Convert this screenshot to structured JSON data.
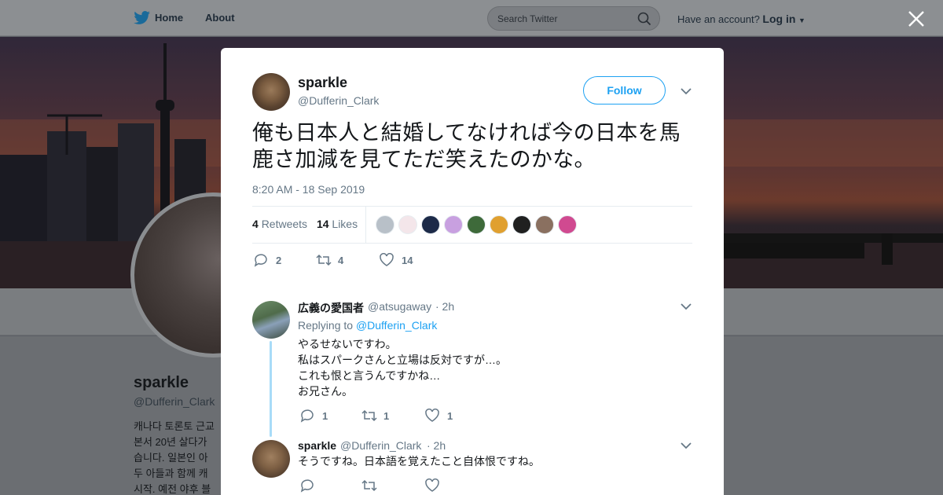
{
  "topbar": {
    "home_label": "Home",
    "about_label": "About",
    "search_placeholder": "Search Twitter",
    "account_prompt": "Have an account?",
    "login_label": "Log in"
  },
  "profile": {
    "name": "sparkle",
    "handle": "@Dufferin_Clark",
    "bio_lines": [
      "캐나다 토론토 근교",
      "본서 20년 살다가",
      "습니다. 일본인 아",
      "두 아들과 함께 캐",
      "시작. 예전 야후 블"
    ]
  },
  "tweet": {
    "author_name": "sparkle",
    "author_handle": "@Dufferin_Clark",
    "follow_label": "Follow",
    "text": "俺も日本人と結婚してなければ今の日本を馬鹿さ加減を見てただ笑えたのかな。",
    "timestamp": "8:20 AM - 18 Sep 2019",
    "retweets_count": "4",
    "retweets_label": "Retweets",
    "likes_count": "14",
    "likes_label": "Likes",
    "reply_count": "2",
    "retweet_count": "4",
    "like_count": "14",
    "liker_avatar_colors": [
      "#b8c0c8",
      "#f4e6ea",
      "#1c2a48",
      "#c8a0e0",
      "#3e6a3a",
      "#e0a030",
      "#202020",
      "#8a7060",
      "#d04a90"
    ]
  },
  "replies": [
    {
      "name": "広義の愛国者",
      "handle": "@atsugaway",
      "time": "· 2h",
      "replying_prefix": "Replying to",
      "replying_to": "@Dufferin_Clark",
      "lines": [
        "やるせないですわ。",
        "私はスパークさんと立場は反対ですが…。",
        "これも恨と言うんですかね…",
        "お兄さん。"
      ],
      "reply_count": "1",
      "retweet_count": "1",
      "like_count": "1"
    },
    {
      "name": "sparkle",
      "handle": "@Dufferin_Clark",
      "time": "· 2h",
      "lines": [
        "そうですね。日本語を覚えたこと自体恨ですね。"
      ]
    }
  ]
}
